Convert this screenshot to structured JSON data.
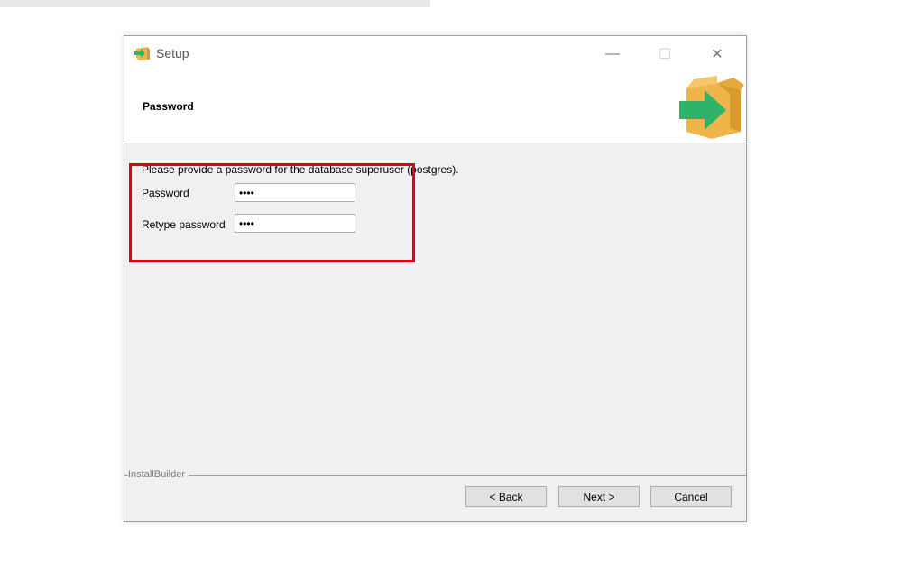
{
  "window": {
    "title": "Setup",
    "icon": "installer-box-icon",
    "controls": {
      "minimize": "—",
      "maximize": "☐",
      "close": "✕"
    }
  },
  "header": {
    "title": "Password",
    "logo": "installer-box-arrow-logo"
  },
  "form": {
    "prompt": "Please provide a password for the database superuser (postgres).",
    "password_label": "Password",
    "password_value": "••••",
    "retype_label": "Retype password",
    "retype_value": "••••"
  },
  "footer": {
    "brand": "InstallBuilder",
    "back_label": "< Back",
    "next_label": "Next >",
    "cancel_label": "Cancel"
  },
  "colors": {
    "highlight": "#e3000f",
    "arrow_green": "#2fb36b",
    "box_tan": "#f0b54a"
  }
}
